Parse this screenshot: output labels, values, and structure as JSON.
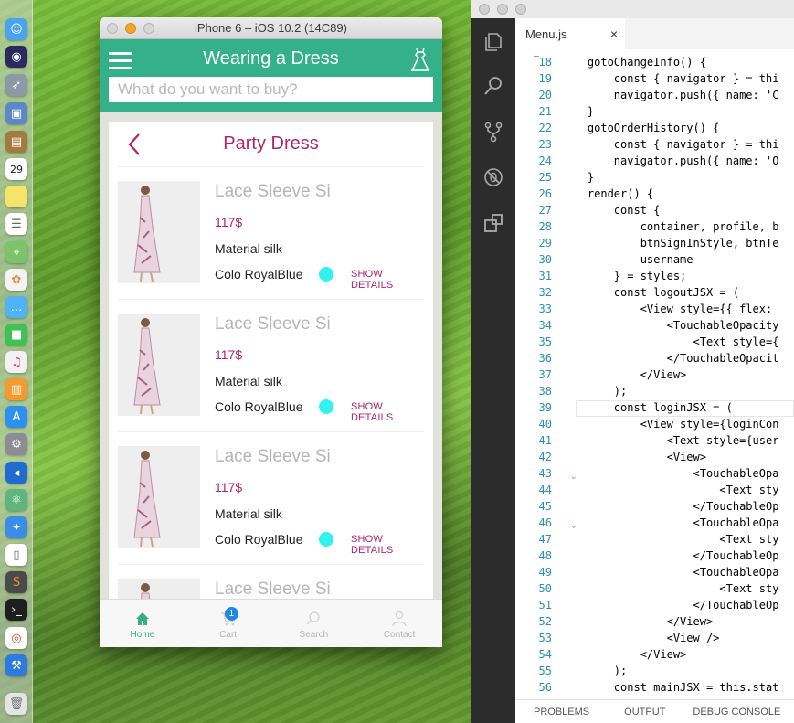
{
  "simulator": {
    "window_title": "iPhone 6 – iOS 10.2 (14C89)",
    "app_title": "Wearing a Dress",
    "search_placeholder": "What do you want to buy?",
    "category_title": "Party Dress",
    "products": [
      {
        "name": "Lace Sleeve Si",
        "price": "117$",
        "material": "Material silk",
        "color": "Colo RoyalBlue",
        "action": "SHOW DETAILS"
      },
      {
        "name": "Lace Sleeve Si",
        "price": "117$",
        "material": "Material silk",
        "color": "Colo RoyalBlue",
        "action": "SHOW DETAILS"
      },
      {
        "name": "Lace Sleeve Si",
        "price": "117$",
        "material": "Material silk",
        "color": "Colo RoyalBlue",
        "action": "SHOW DETAILS"
      },
      {
        "name": "Lace Sleeve Si"
      }
    ],
    "tabs": [
      {
        "label": "Home",
        "icon": "home-icon",
        "active": true
      },
      {
        "label": "Cart",
        "icon": "cart-icon",
        "badge": "1"
      },
      {
        "label": "Search",
        "icon": "search-icon"
      },
      {
        "label": "Contact",
        "icon": "person-icon"
      }
    ],
    "colors": {
      "header": "#35b18a",
      "accent": "#b0256f",
      "swatch": "#31f2ef"
    }
  },
  "editor": {
    "tab_label": "Menu.js",
    "close_glyph": "×",
    "panel_tabs": [
      "PROBLEMS",
      "OUTPUT",
      "DEBUG CONSOLE"
    ],
    "lines": [
      {
        "n": "18",
        "t": "    gotoChangeInfo() {"
      },
      {
        "n": "19",
        "t": "        const { navigator } = thi"
      },
      {
        "n": "20",
        "t": "        navigator.push({ name: 'C"
      },
      {
        "n": "21",
        "t": "    }"
      },
      {
        "n": "22",
        "t": "    gotoOrderHistory() {"
      },
      {
        "n": "23",
        "t": "        const { navigator } = thi"
      },
      {
        "n": "24",
        "t": "        navigator.push({ name: 'O"
      },
      {
        "n": "25",
        "t": "    }"
      },
      {
        "n": "26",
        "t": "    render() {"
      },
      {
        "n": "27",
        "t": "        const {"
      },
      {
        "n": "28",
        "t": "            container, profile, b"
      },
      {
        "n": "29",
        "t": "            btnSignInStyle, btnTe"
      },
      {
        "n": "30",
        "t": "            username"
      },
      {
        "n": "31",
        "t": "        } = styles;"
      },
      {
        "n": "32",
        "t": "        const logoutJSX = ("
      },
      {
        "n": "33",
        "t": "            <View style={{ flex:"
      },
      {
        "n": "34",
        "t": "                <TouchableOpacity"
      },
      {
        "n": "35",
        "t": "                    <Text style={"
      },
      {
        "n": "36",
        "t": "                </TouchableOpacit"
      },
      {
        "n": "37",
        "t": "            </View>"
      },
      {
        "n": "38",
        "t": "        );"
      },
      {
        "n": "39",
        "t": "        const loginJSX = ("
      },
      {
        "n": "40",
        "t": "            <View style={loginCon"
      },
      {
        "n": "41",
        "t": "                <Text style={user"
      },
      {
        "n": "42",
        "t": "                <View>"
      },
      {
        "n": "43",
        "t": "                    <TouchableOpa"
      },
      {
        "n": "44",
        "t": "                        <Text sty"
      },
      {
        "n": "45",
        "t": "                    </TouchableOp"
      },
      {
        "n": "46",
        "t": "                    <TouchableOpa"
      },
      {
        "n": "47",
        "t": "                        <Text sty"
      },
      {
        "n": "48",
        "t": "                    </TouchableOp"
      },
      {
        "n": "49",
        "t": "                    <TouchableOpa"
      },
      {
        "n": "50",
        "t": "                        <Text sty"
      },
      {
        "n": "51",
        "t": "                    </TouchableOp"
      },
      {
        "n": "52",
        "t": "                </View>"
      },
      {
        "n": "53",
        "t": "                <View />"
      },
      {
        "n": "54",
        "t": "            </View>"
      },
      {
        "n": "55",
        "t": "        );"
      },
      {
        "n": "56",
        "t": "        const mainJSX = this.stat"
      }
    ]
  },
  "dock": {
    "icons": [
      "finder-icon",
      "siri-icon",
      "launchpad-icon",
      "preview-icon",
      "notes-icon",
      "calendar-icon",
      "stickies-icon",
      "reminders-icon",
      "maps-icon",
      "photos-icon",
      "messages-icon",
      "facetime-icon",
      "itunes-icon",
      "ibooks-icon",
      "app-store-icon",
      "system-preferences-icon",
      "vscode-icon",
      "atom-icon",
      "safari-icon",
      "textedit-icon",
      "sublime-icon",
      "terminal-icon",
      "chrome-icon",
      "xcode-icon",
      "trash-icon"
    ],
    "calendar_day": "29"
  }
}
